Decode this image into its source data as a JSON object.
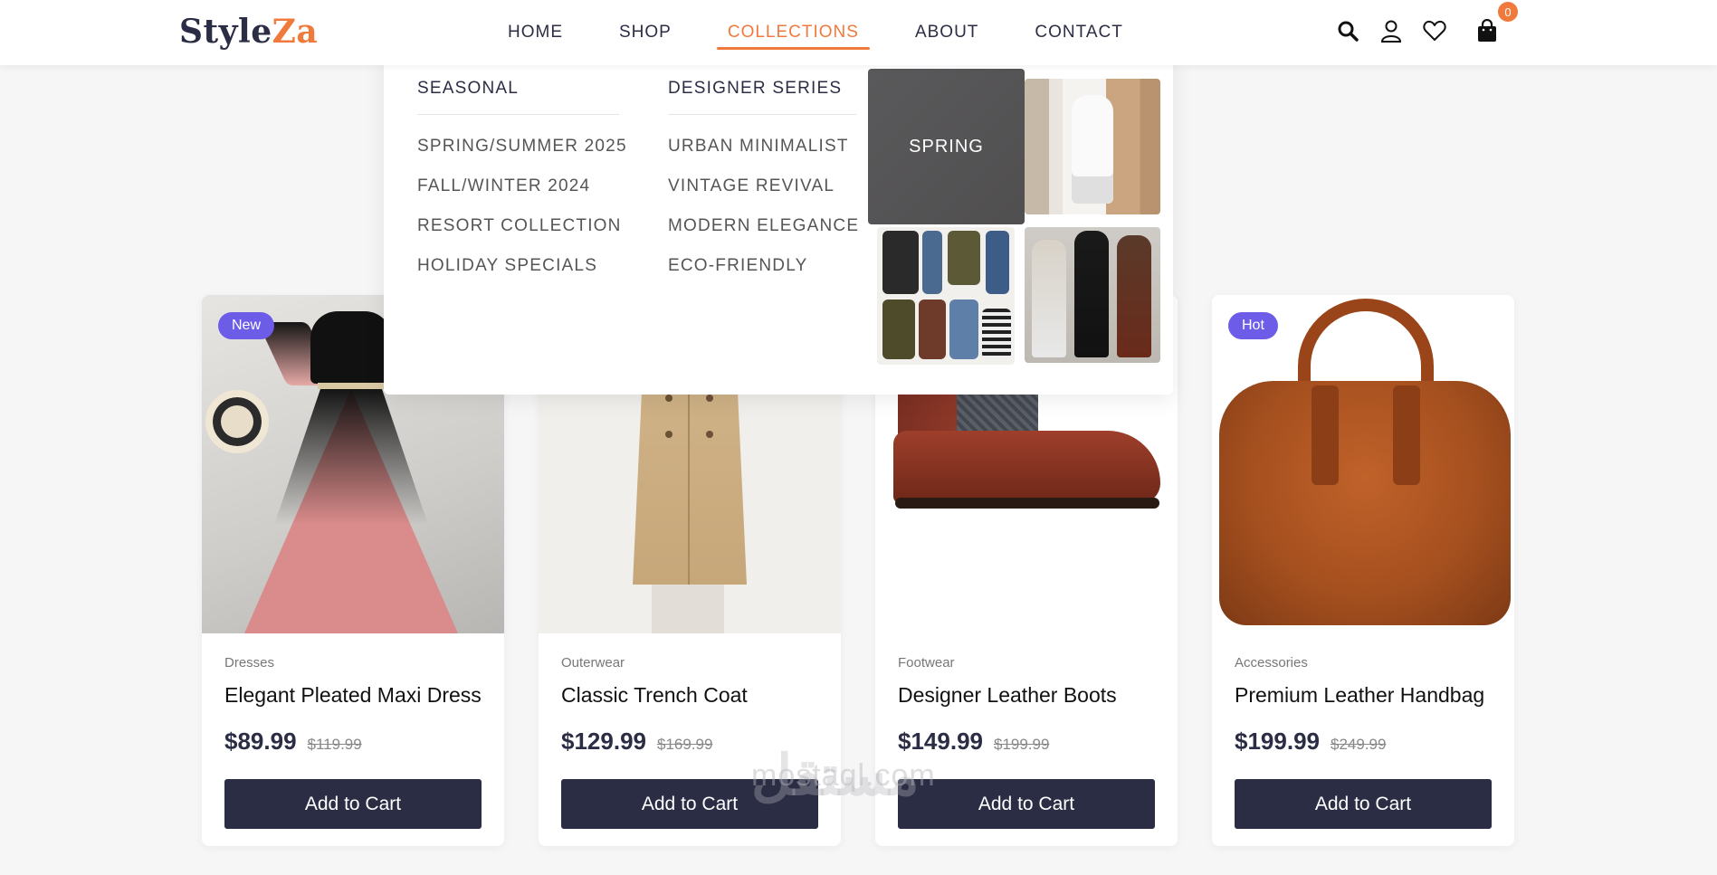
{
  "brand": {
    "logo_main": "Style",
    "logo_accent": "Za"
  },
  "nav": {
    "items": [
      "HOME",
      "SHOP",
      "COLLECTIONS",
      "ABOUT",
      "CONTACT"
    ],
    "active": "COLLECTIONS"
  },
  "header_icons": [
    "search-icon",
    "user-icon",
    "heart-icon",
    "shopping-bag-icon"
  ],
  "cart": {
    "count": "0"
  },
  "mega_menu": {
    "seasonal": {
      "title": "SEASONAL",
      "links": [
        "SPRING/SUMMER 2025",
        "FALL/WINTER 2024",
        "RESORT COLLECTION",
        "HOLIDAY SPECIALS"
      ]
    },
    "designer": {
      "title": "DESIGNER SERIES",
      "links": [
        "URBAN MINIMALIST",
        "VINTAGE REVIVAL",
        "MODERN ELEGANCE",
        "ECO-FRIENDLY"
      ]
    },
    "featured_label": "SPRING"
  },
  "products": [
    {
      "badge": "New",
      "category": "Dresses",
      "name": "Elegant Pleated Maxi Dress",
      "price": "$89.99",
      "old_price": "$119.99",
      "button": "Add to Cart"
    },
    {
      "badge": "",
      "category": "Outerwear",
      "name": "Classic Trench Coat",
      "price": "$129.99",
      "old_price": "$169.99",
      "button": "Add to Cart"
    },
    {
      "badge": "",
      "category": "Footwear",
      "name": "Designer Leather Boots",
      "price": "$149.99",
      "old_price": "$199.99",
      "button": "Add to Cart"
    },
    {
      "badge": "Hot",
      "category": "Accessories",
      "name": "Premium Leather Handbag",
      "price": "$199.99",
      "old_price": "$249.99",
      "button": "Add to Cart"
    }
  ],
  "watermark": {
    "text": "mostaql.com",
    "arabic": "مستقل"
  },
  "colors": {
    "accent": "#f07a3c",
    "primary": "#2b2d45",
    "badge": "#6c5ce7"
  }
}
